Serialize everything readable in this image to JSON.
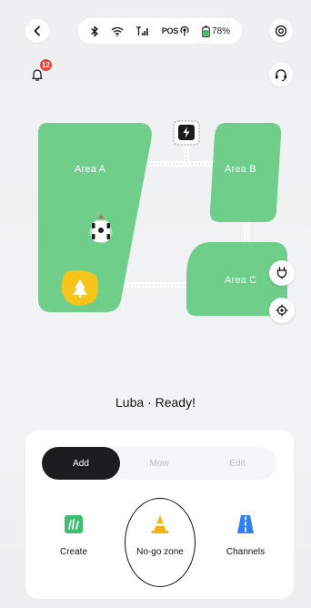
{
  "header": {
    "back_icon": "chevron-left-icon",
    "status": {
      "bluetooth_icon": "bluetooth-icon",
      "wifi_icon": "wifi-icon",
      "signal_icon": "cellular-signal-icon",
      "pos_label": "POS",
      "battery_percent": "78%"
    },
    "settings_icon": "settings-icon",
    "notification_count": "12",
    "support_icon": "headset-icon"
  },
  "map": {
    "areas": [
      {
        "label": "Area A"
      },
      {
        "label": "Area B"
      },
      {
        "label": "Area C"
      }
    ],
    "colors": {
      "lawn": "#6fce8a",
      "path": "#ffffff",
      "obstacle": "#f5c51b"
    }
  },
  "status_title": "Luba · Ready!",
  "panel": {
    "tabs": [
      {
        "label": "Add",
        "active": true
      },
      {
        "label": "Mow",
        "active": false
      },
      {
        "label": "Edit",
        "active": false
      }
    ],
    "actions": [
      {
        "label": "Create",
        "icon": "create-area-icon"
      },
      {
        "label": "No-go zone",
        "icon": "traffic-cone-icon"
      },
      {
        "label": "Channels",
        "icon": "channel-road-icon"
      }
    ]
  }
}
